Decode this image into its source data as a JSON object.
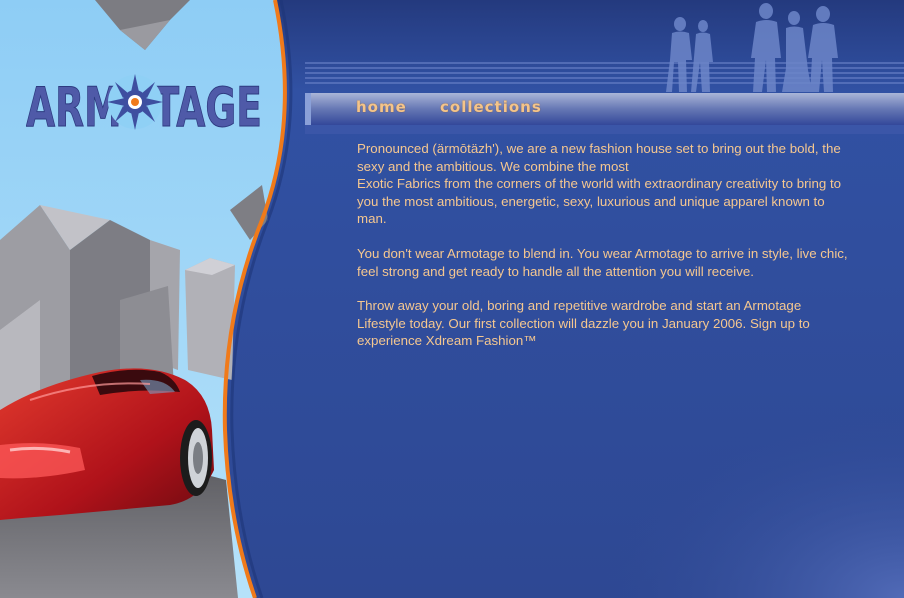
{
  "brand": {
    "logo_text": "ARMOTAGE"
  },
  "nav": {
    "home": "home",
    "collections": "collections"
  },
  "content": {
    "p1": "Pronounced (ärmōtäzh'), we are a new fashion house set to bring out the bold, the sexy and the ambitious. We combine the most",
    "p1b": "Exotic Fabrics from the corners of the world with extraordinary creativity to bring to you the most ambitious, energetic, sexy, luxurious and unique apparel known to man.",
    "p2": "You don't wear Armotage to blend in. You wear Armotage to arrive in style, live chic, feel strong and get ready to handle all the attention you will receive.",
    "p3": "Throw away your old, boring and repetitive wardrobe and start an Armotage Lifestyle today. Our first collection will dazzle you in January 2006. Sign up to experience Xdream Fashion™"
  },
  "colors": {
    "main_bg": "#2f4a96",
    "sky": "#8fd0f5",
    "accent_orange": "#f07a1a",
    "text": "#f5c790",
    "car_red": "#c01818"
  },
  "icons": {
    "silhouettes": "people-silhouettes-icon",
    "car": "red-sports-car-icon",
    "buildings": "city-buildings-icon"
  }
}
